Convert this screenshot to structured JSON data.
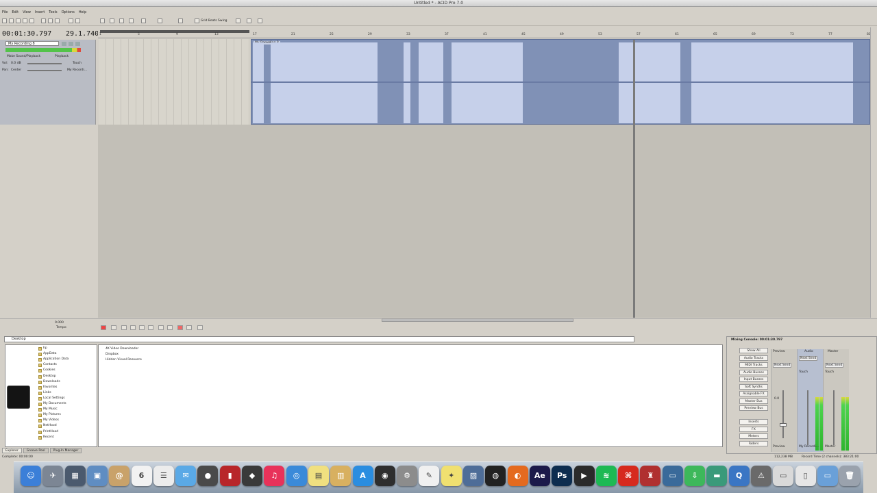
{
  "window": {
    "title": "Untitled * - ACID Pro 7.0"
  },
  "menu": {
    "items": [
      "File",
      "Edit",
      "View",
      "Insert",
      "Tools",
      "Options",
      "Help"
    ]
  },
  "toolbar": {
    "snap_label": "Grid Beats Swing"
  },
  "time": {
    "position": "00:01:30.797",
    "beat": "29.1.740"
  },
  "track": {
    "name": "My Recording 8",
    "mode_left": "Make Sound/Playback",
    "mode_right": "Playback",
    "vol_label": "Vol:",
    "vol_value": "0.0 dB",
    "touch_label": "Touch",
    "pan_label": "Pan:",
    "pan_value": "Center",
    "fx_label": "My Recordi..."
  },
  "ruler": {
    "ticks": [
      "1",
      "5",
      "9",
      "13",
      "17",
      "21",
      "25",
      "29",
      "33",
      "37",
      "41",
      "45",
      "49",
      "53",
      "57",
      "61",
      "65",
      "69",
      "73",
      "77",
      "81"
    ]
  },
  "clip": {
    "label": "My Recording 8"
  },
  "transport": {
    "rate": "0.000",
    "rate2": "Tempo"
  },
  "browser": {
    "path": "Desktop",
    "tree": [
      "hp",
      "AppData",
      "Application Data",
      "Contacts",
      "Cookies",
      "Desktop",
      "Downloads",
      "Favorites",
      "Links",
      "Local Settings",
      "My Documents",
      "My Music",
      "My Pictures",
      "My Videos",
      "NetHood",
      "PrintHood",
      "Recent"
    ],
    "files": [
      "4K Video Downloader",
      "Dropbox",
      "Hidden Visual Resource"
    ],
    "tabs": [
      "Explorer",
      "Groove Pool",
      "Plug-In Manager"
    ]
  },
  "mixer": {
    "title": "Mixing Console: 00:01:30.797",
    "buttons": [
      "Show All",
      "Audio Tracks",
      "MIDI Tracks",
      "Audio Busses",
      "Input Busses",
      "Soft Synths",
      "Assignable FX",
      "Master Bus",
      "Preview Bus",
      "Inserts",
      "FX",
      "Meters",
      "Faders"
    ],
    "strips": [
      "Preview",
      "My Recordi...",
      "Master"
    ],
    "strip_headers": [
      "Preview",
      "Audio",
      "Master"
    ],
    "strip_audio_label": "Next Send",
    "strip_touch": "Touch",
    "strip_value": "0.0"
  },
  "status": {
    "left": "Complete: 00:00:00",
    "mid": "112,238 MB",
    "right": "Record Time (2 channels): 383:21:00"
  },
  "dock": {
    "apps": [
      {
        "name": "Finder",
        "color": "#3b7fd8",
        "glyph": "☺"
      },
      {
        "name": "Launchpad",
        "color": "#7c8694",
        "glyph": "✈"
      },
      {
        "name": "Mission Control",
        "color": "#4b5a6e",
        "glyph": "▦"
      },
      {
        "name": "Preview",
        "color": "#5f8dc2",
        "glyph": "▣"
      },
      {
        "name": "Contacts",
        "color": "#c9a26a",
        "glyph": "@"
      },
      {
        "name": "Calendar",
        "color": "#f2f2f2",
        "glyph": "6"
      },
      {
        "name": "Reminders",
        "color": "#ececec",
        "glyph": "☰"
      },
      {
        "name": "Messages",
        "color": "#5aa9e6",
        "glyph": "✉"
      },
      {
        "name": "FaceTime",
        "color": "#4a4a4a",
        "glyph": "●"
      },
      {
        "name": "Photo Booth",
        "color": "#b8262a",
        "glyph": "▮"
      },
      {
        "name": "iPhoto",
        "color": "#3a3a3a",
        "glyph": "◆"
      },
      {
        "name": "iTunes",
        "color": "#e8325a",
        "glyph": "♫"
      },
      {
        "name": "Safari",
        "color": "#3a8ad9",
        "glyph": "◎"
      },
      {
        "name": "Stickies",
        "color": "#f0e080",
        "glyph": "▤"
      },
      {
        "name": "Preview2",
        "color": "#d8b060",
        "glyph": "▥"
      },
      {
        "name": "App Store",
        "color": "#2a8de0",
        "glyph": "A"
      },
      {
        "name": "Logic",
        "color": "#2e2e2e",
        "glyph": "◉"
      },
      {
        "name": "System Preferences",
        "color": "#8c8c8c",
        "glyph": "⚙"
      },
      {
        "name": "TextEdit",
        "color": "#f0f0f0",
        "glyph": "✎"
      },
      {
        "name": "Stickies2",
        "color": "#f0e070",
        "glyph": "✦"
      },
      {
        "name": "Image Capture",
        "color": "#4e6d98",
        "glyph": "▨"
      },
      {
        "name": "DVD Player",
        "color": "#222222",
        "glyph": "◍"
      },
      {
        "name": "Firefox",
        "color": "#e46a1f",
        "glyph": "◐"
      },
      {
        "name": "After Effects",
        "color": "#1c1a4a",
        "glyph": "Ae"
      },
      {
        "name": "Photoshop",
        "color": "#0d2d4f",
        "glyph": "Ps"
      },
      {
        "name": "Final Cut",
        "color": "#2b2b2b",
        "glyph": "▶"
      },
      {
        "name": "Spotify",
        "color": "#1db954",
        "glyph": "≋"
      },
      {
        "name": "Acrobat",
        "color": "#d62a1e",
        "glyph": "⌘"
      },
      {
        "name": "Utility",
        "color": "#b03030",
        "glyph": "♜"
      },
      {
        "name": "Monitor",
        "color": "#3a6a9a",
        "glyph": "▭"
      },
      {
        "name": "Downloader",
        "color": "#3db85b",
        "glyph": "⇩"
      },
      {
        "name": "Folder",
        "color": "#3a9a7a",
        "glyph": "▬"
      },
      {
        "name": "QuickTime",
        "color": "#3a76c4",
        "glyph": "Q"
      },
      {
        "name": "Automator",
        "color": "#6a6a6a",
        "glyph": "⚠"
      },
      {
        "name": "Terminal",
        "color": "#d9d9d9",
        "glyph": "▭"
      },
      {
        "name": "Documents",
        "color": "#e6e6e6",
        "glyph": "▯"
      },
      {
        "name": "Downloads Folder",
        "color": "#6aa0d8",
        "glyph": "▭"
      },
      {
        "name": "Trash",
        "color": "#9aa2ad",
        "glyph": "🗑"
      }
    ]
  }
}
